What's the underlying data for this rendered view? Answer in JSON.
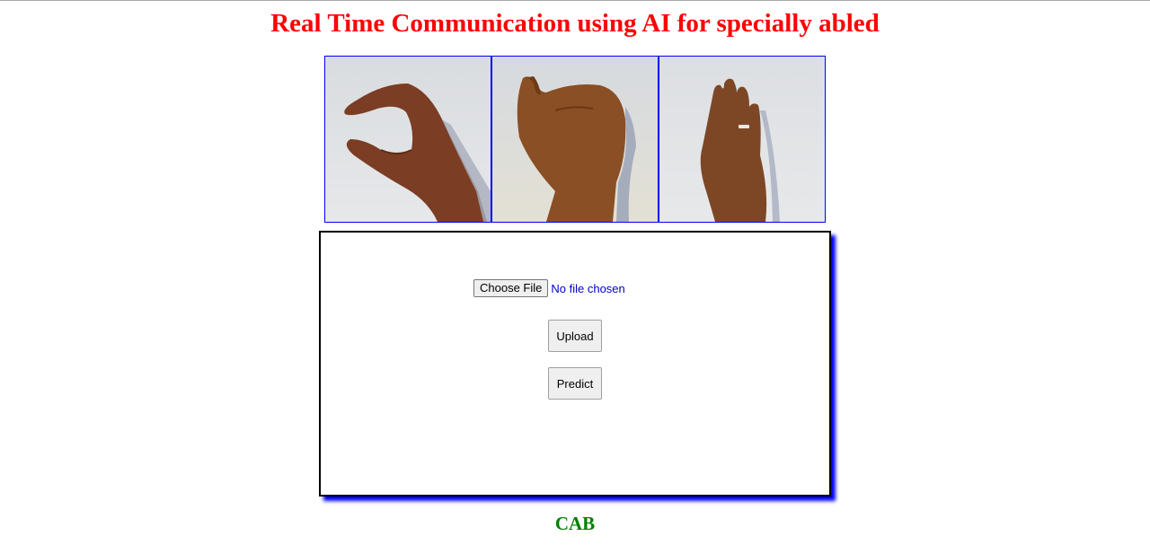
{
  "page": {
    "title": "Real Time Communication using AI for specially abled"
  },
  "gallery": {
    "images": [
      {
        "icon": "hand-sign-c-image"
      },
      {
        "icon": "hand-sign-a-image"
      },
      {
        "icon": "hand-sign-b-image"
      }
    ]
  },
  "form": {
    "choose_file_label": "Choose File",
    "file_status": "No file chosen",
    "upload_label": "Upload",
    "predict_label": "Predict"
  },
  "result": {
    "text": "CAB"
  },
  "colors": {
    "title": "#ff0000",
    "result": "#008000",
    "border_accent": "#0000ff",
    "file_status": "#0000cc"
  }
}
